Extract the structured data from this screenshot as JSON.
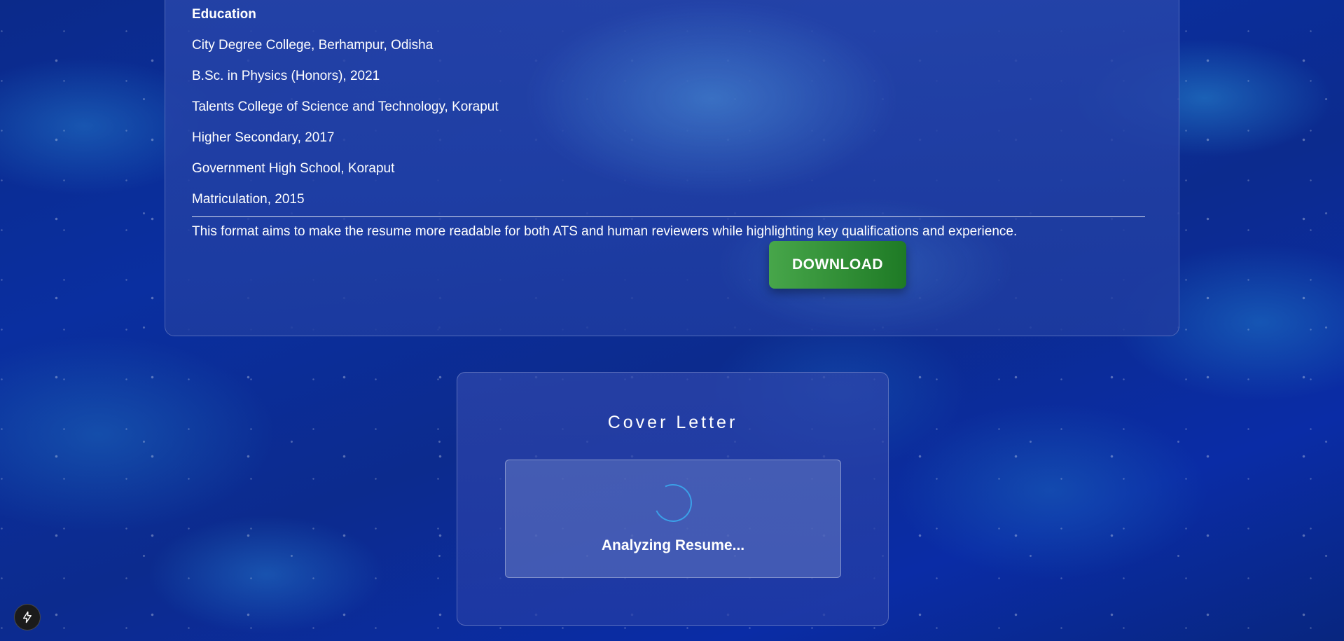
{
  "resume": {
    "education_heading": "Education",
    "education_lines": [
      "City Degree College, Berhampur, Odisha",
      "B.Sc. in Physics (Honors), 2021",
      "Talents College of Science and Technology, Koraput",
      "Higher Secondary, 2017",
      "Government High School, Koraput",
      "Matriculation, 2015"
    ],
    "summary": "This format aims to make the resume more readable for both ATS and human reviewers while highlighting key qualifications and experience.",
    "download_label": "DOWNLOAD"
  },
  "cover_letter": {
    "title": "Cover Letter",
    "status": "Analyzing Resume..."
  },
  "icons": {
    "corner_badge": "lightning-bolt-icon",
    "spinner": "loading-spinner-icon"
  },
  "colors": {
    "download_button_start": "#47a64a",
    "download_button_end": "#1e7a25",
    "spinner": "#3ba0e8"
  }
}
